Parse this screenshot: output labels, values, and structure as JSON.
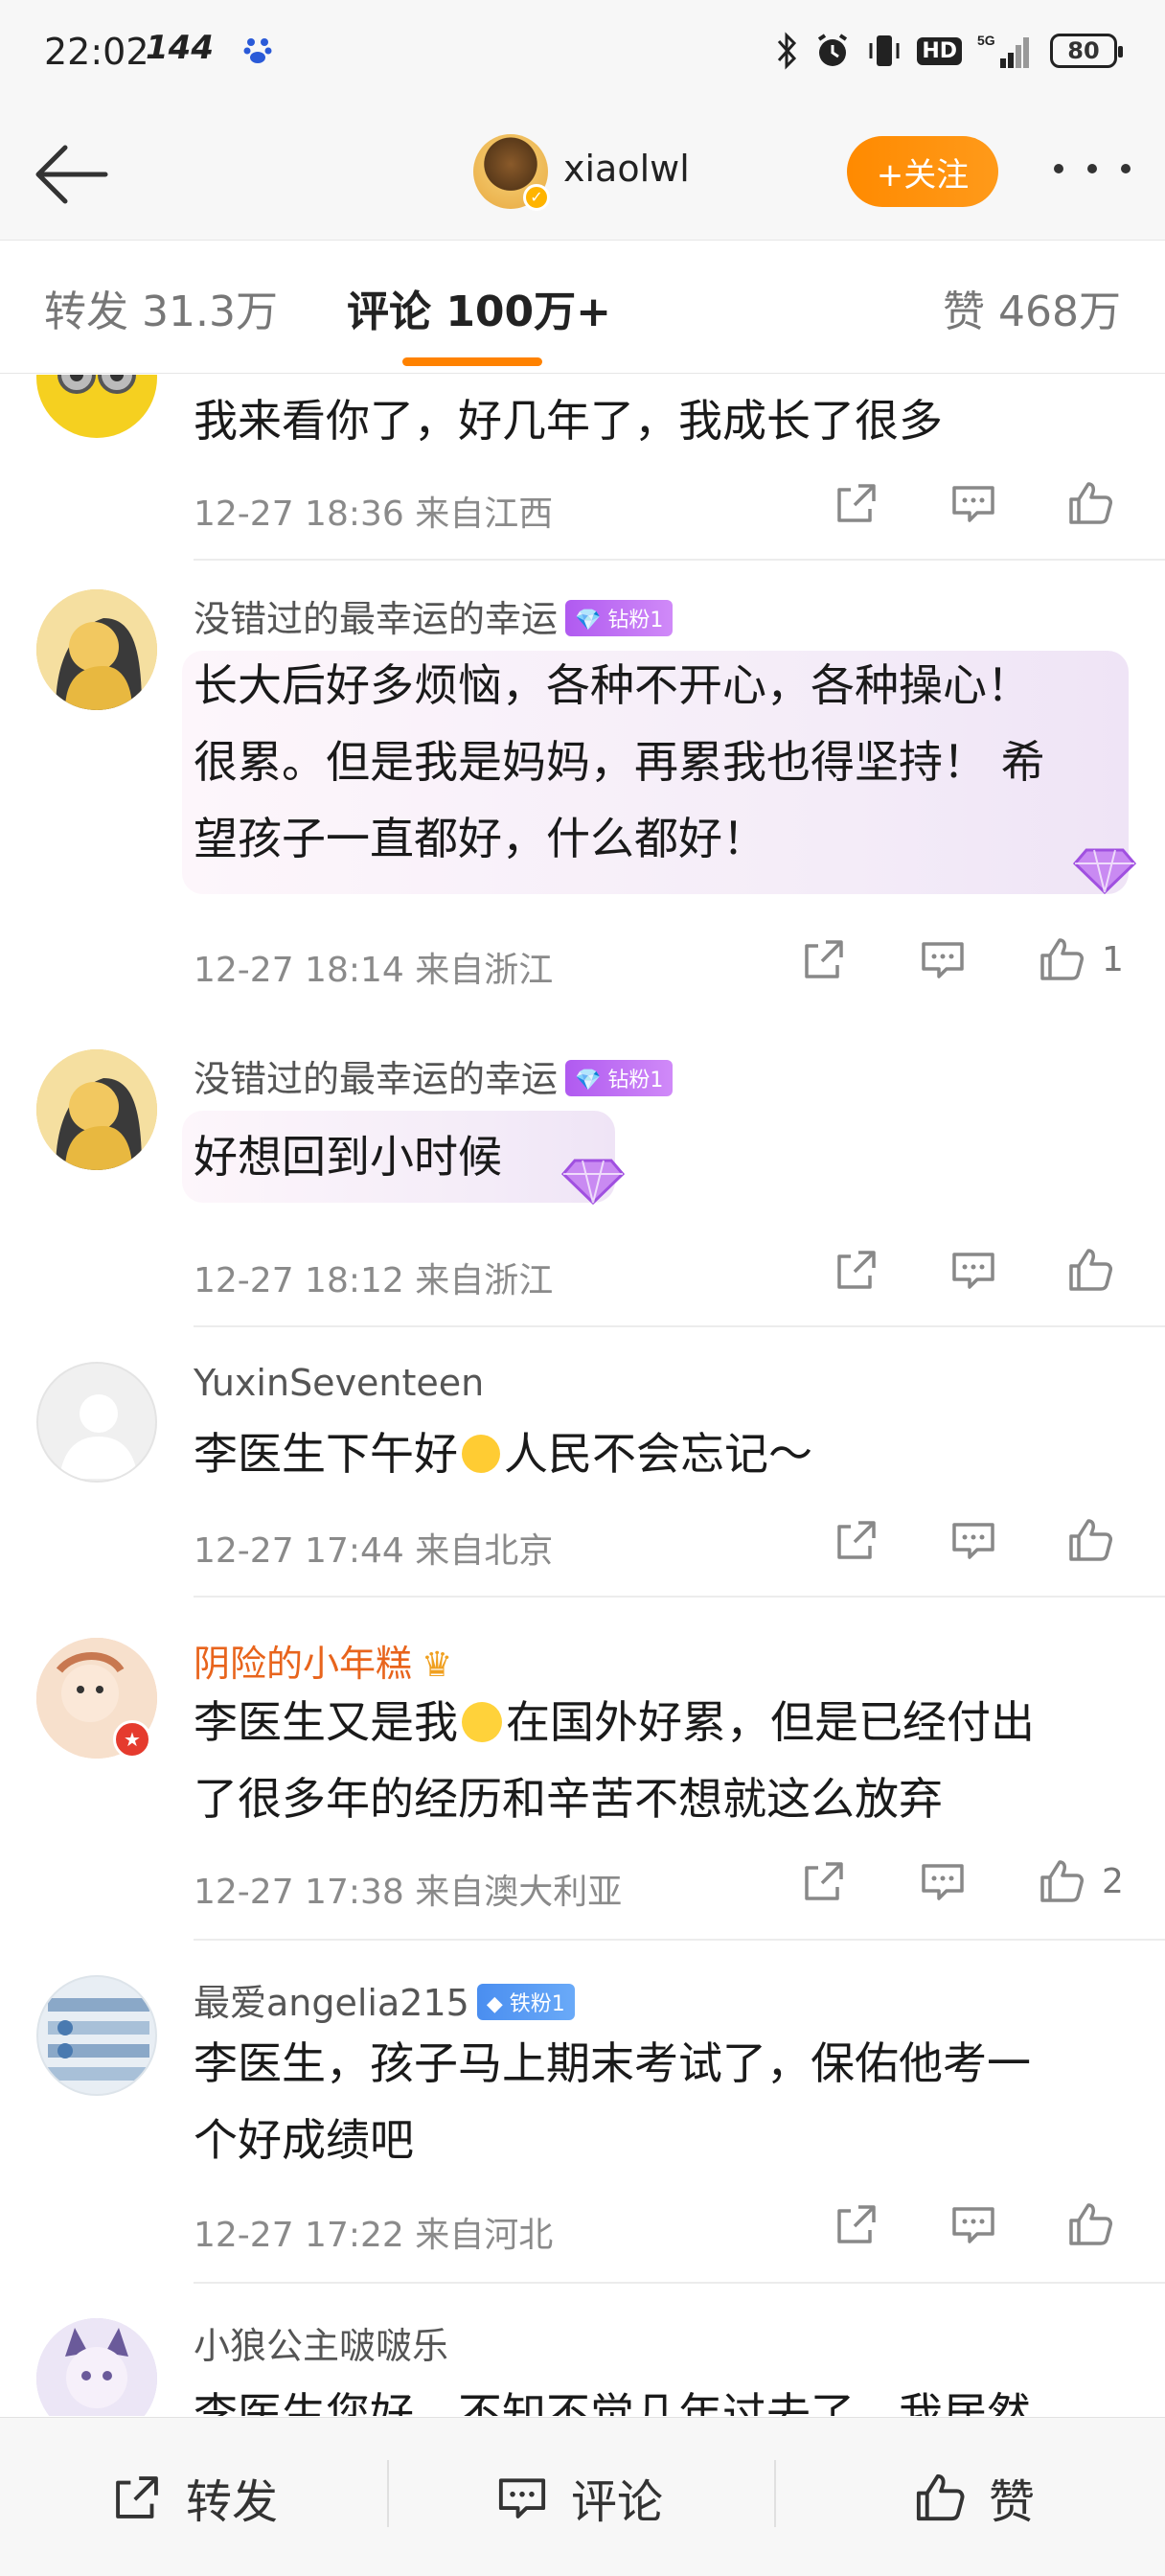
{
  "status_bar": {
    "time": "22:02",
    "refresh_rate": "144",
    "network": "5G",
    "hd": "HD",
    "battery": "80"
  },
  "header": {
    "username": "xiaolwl",
    "follow_label": "+关注"
  },
  "tabs": {
    "repost": "转发 31.3万",
    "comment": "评论 100万+",
    "like": "赞 468万"
  },
  "comments": [
    {
      "name": "",
      "lines": [
        "我来看你了，好几年了，我成长了很多"
      ],
      "meta": "12-27 18:36  来自江西",
      "likes": ""
    },
    {
      "name": "没错过的最幸运的幸运",
      "badge": "钻粉1",
      "lines": [
        "长大后好多烦恼，各种不开心，各种操心！",
        "很累。但是我是妈妈，再累我也得坚持！ 希",
        "望孩子一直都好，什么都好！"
      ],
      "meta": "12-27 18:14  来自浙江",
      "likes": "1"
    },
    {
      "name": "没错过的最幸运的幸运",
      "badge": "钻粉1",
      "lines": [
        "好想回到小时候"
      ],
      "meta": "12-27 18:12  来自浙江",
      "likes": ""
    },
    {
      "name": "YuxinSeventeen",
      "lines": [
        "李医生下午好",
        "人民不会忘记～"
      ],
      "meta": "12-27 17:44  来自北京",
      "likes": ""
    },
    {
      "name": "阴险的小年糕",
      "lines": [
        "李医生又是我",
        "在国外好累，但是已经付出",
        "了很多年的经历和辛苦不想就这么放弃"
      ],
      "meta": "12-27 17:38  来自澳大利亚",
      "likes": "2"
    },
    {
      "name": "最爱angelia215",
      "badge": "铁粉1",
      "lines": [
        "李医生，孩子马上期末考试了，保佑他考一",
        "个好成绩吧"
      ],
      "meta": "12-27 17:22  来自河北",
      "likes": ""
    },
    {
      "name": "小狼公主啵啵乐",
      "lines": [
        "李医生您好，不知不觉几年过去了，我居然"
      ],
      "meta": "",
      "likes": ""
    }
  ],
  "bottom_bar": {
    "repost": "转发",
    "comment": "评论",
    "like": "赞"
  },
  "colors": {
    "accent_orange": "#ff8200",
    "vip_name": "#e8641c",
    "diamond_badge": "#b05af0",
    "iron_badge": "#4a8ef0"
  }
}
